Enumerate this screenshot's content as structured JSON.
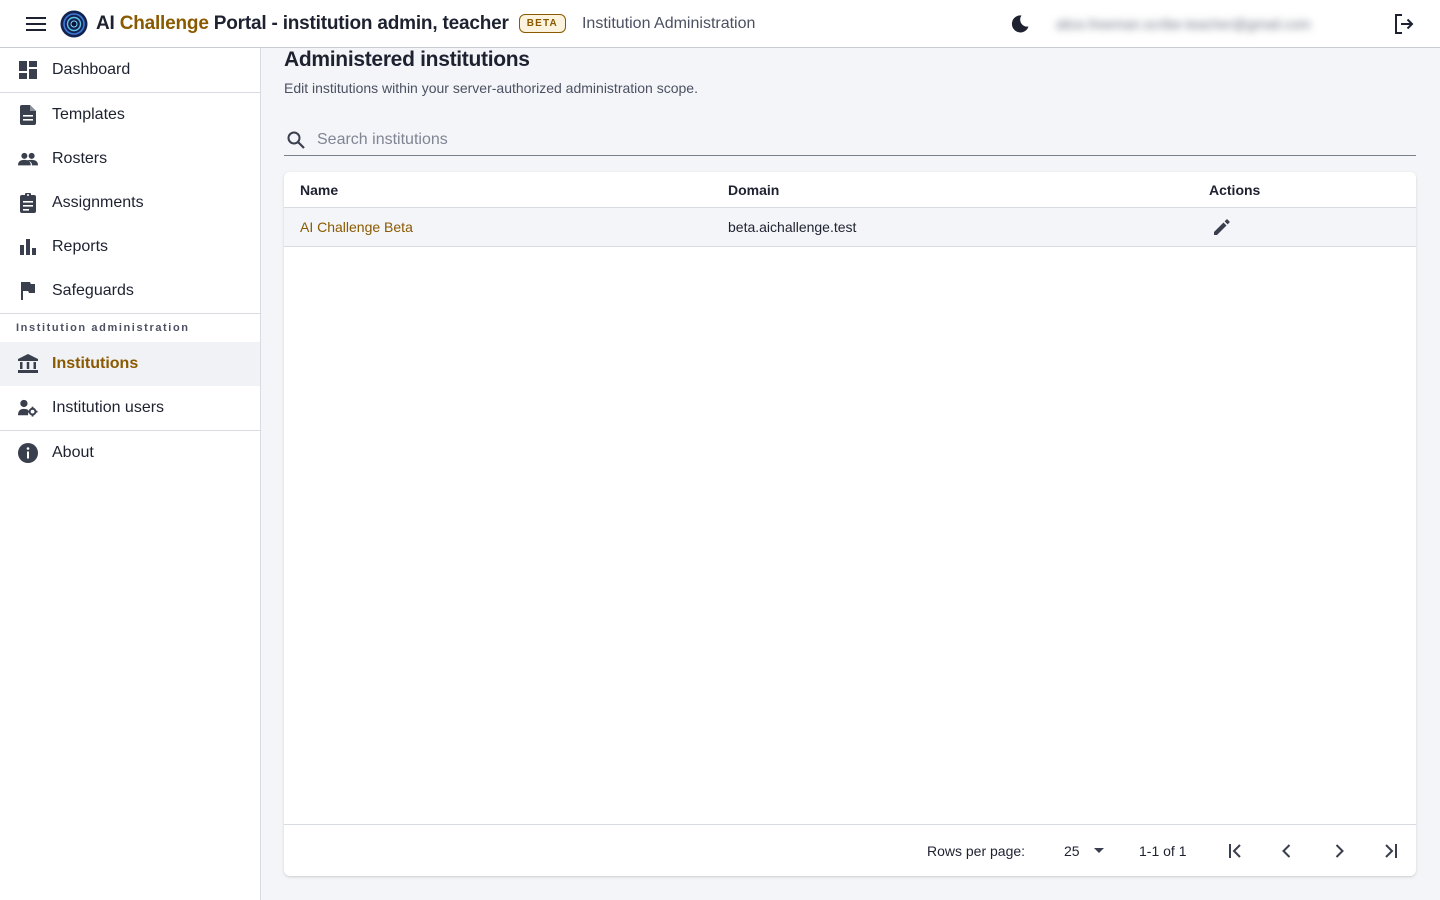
{
  "header": {
    "title_prefix": "AI ",
    "title_accent": "Challenge",
    "title_suffix": " Portal - institution admin, teacher",
    "badge": "BETA",
    "section": "Institution Administration",
    "user_email": "alice.freeman.scribe-teacher@gmail.com"
  },
  "sidebar": {
    "items": [
      {
        "label": "Dashboard",
        "icon": "dashboard-icon"
      },
      {
        "label": "Templates",
        "icon": "document-icon"
      },
      {
        "label": "Rosters",
        "icon": "people-icon"
      },
      {
        "label": "Assignments",
        "icon": "clipboard-icon"
      },
      {
        "label": "Reports",
        "icon": "bar-chart-icon"
      },
      {
        "label": "Safeguards",
        "icon": "flag-icon"
      }
    ],
    "section_label": "Institution administration",
    "admin_items": [
      {
        "label": "Institutions",
        "icon": "bank-icon",
        "active": true
      },
      {
        "label": "Institution users",
        "icon": "user-settings-icon"
      }
    ],
    "about": {
      "label": "About",
      "icon": "info-icon"
    }
  },
  "main": {
    "title": "Administered institutions",
    "subtitle": "Edit institutions within your server-authorized administration scope.",
    "search": {
      "placeholder": "Search institutions",
      "value": ""
    },
    "table": {
      "columns": [
        "Name",
        "Domain",
        "Actions"
      ],
      "rows": [
        {
          "name": "AI Challenge Beta",
          "domain": "beta.aichallenge.test"
        }
      ]
    },
    "footer": {
      "rows_per_page_label": "Rows per page:",
      "rows_per_page": "25",
      "range": "1-1 of 1"
    }
  },
  "colors": {
    "accent": "#8a5a00",
    "text": "#1e2230",
    "muted": "#4b5162",
    "background": "#f4f5f8"
  }
}
